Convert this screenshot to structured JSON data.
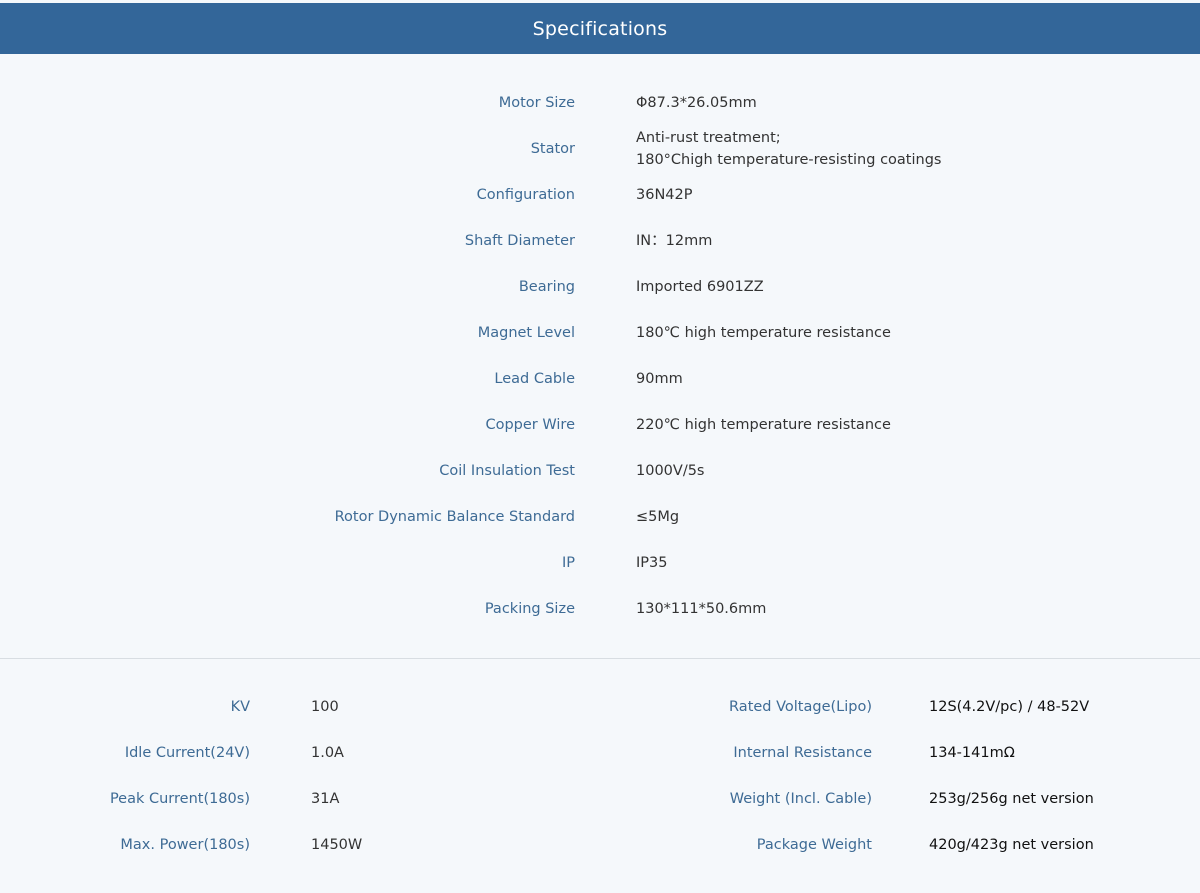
{
  "header": {
    "title": "Specifications"
  },
  "specs": [
    {
      "label": "Motor Size",
      "value_lines": [
        "Φ87.3*26.05mm"
      ]
    },
    {
      "label": "Stator",
      "value_lines": [
        "Anti-rust treatment;",
        "180°Chigh temperature-resisting coatings"
      ]
    },
    {
      "label": "Configuration",
      "value_lines": [
        "36N42P"
      ]
    },
    {
      "label": "Shaft Diameter",
      "value_lines": [
        "IN：12mm"
      ]
    },
    {
      "label": "Bearing",
      "value_lines": [
        "Imported 6901ZZ"
      ]
    },
    {
      "label": "Magnet Level",
      "value_lines": [
        "180℃ high temperature resistance"
      ]
    },
    {
      "label": "Lead Cable",
      "value_lines": [
        "90mm"
      ]
    },
    {
      "label": "Copper Wire",
      "value_lines": [
        "220℃ high temperature resistance"
      ]
    },
    {
      "label": "Coil Insulation Test",
      "value_lines": [
        "1000V/5s"
      ]
    },
    {
      "label": "Rotor Dynamic Balance Standard",
      "value_lines": [
        "≤5Mg"
      ]
    },
    {
      "label": "IP",
      "value_lines": [
        "IP35"
      ]
    },
    {
      "label": "Packing Size",
      "value_lines": [
        "130*111*50.6mm"
      ]
    }
  ],
  "electrical": [
    {
      "left_label": "KV",
      "left_value": "100",
      "right_label": "Rated Voltage(Lipo)",
      "right_value": "12S(4.2V/pc) / 48-52V"
    },
    {
      "left_label": "Idle Current(24V)",
      "left_value": "1.0A",
      "right_label": "Internal Resistance",
      "right_value": "134-141mΩ"
    },
    {
      "left_label": "Peak Current(180s)",
      "left_value": "31A",
      "right_label": "Weight (Incl. Cable)",
      "right_value": "253g/256g net version"
    },
    {
      "left_label": "Max. Power(180s)",
      "left_value": "1450W",
      "right_label": "Package Weight",
      "right_value": "420g/423g net version"
    }
  ],
  "colors": {
    "header_bg": "#336699",
    "label": "#3e6b95",
    "value": "#333333",
    "page_bg": "#f5f8fb"
  }
}
